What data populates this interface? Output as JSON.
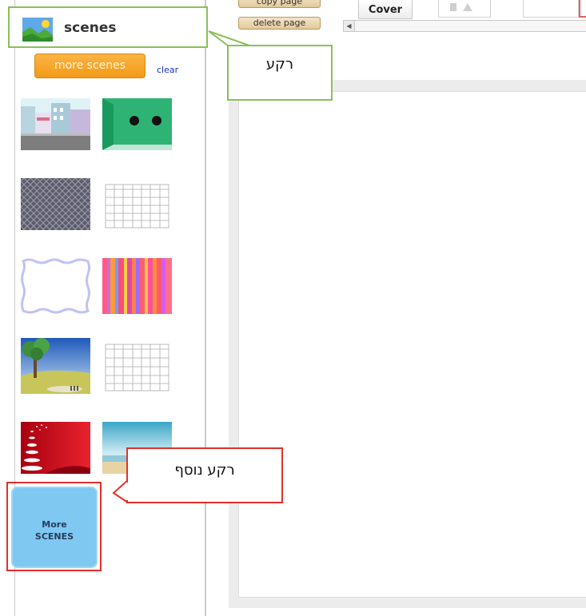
{
  "sidebar": {
    "title": "scenes",
    "more_button_label": "more scenes",
    "clear_label": "clear",
    "thumbnails": [
      {
        "name": "city-street"
      },
      {
        "name": "green-room"
      },
      {
        "name": "diamond-pattern"
      },
      {
        "name": "calendar-grid"
      },
      {
        "name": "wavy-frame"
      },
      {
        "name": "striped-pattern"
      },
      {
        "name": "tree-landscape"
      },
      {
        "name": "calendar-grid-2"
      },
      {
        "name": "red-christmas-tree"
      },
      {
        "name": "beach"
      }
    ],
    "more_tile": {
      "line1": "More",
      "line2": "SCENES"
    }
  },
  "toolbar": {
    "copy_page_label": "copy page",
    "delete_page_label": "delete page",
    "cover_label": "Cover"
  },
  "callouts": {
    "background": "רקע",
    "more_background": "רקע נוסף"
  },
  "colors": {
    "green_highlight": "#8bbf5a",
    "red_highlight": "#e2302b",
    "orange_button": "#f29a18",
    "more_tile": "#7ec8f2"
  }
}
